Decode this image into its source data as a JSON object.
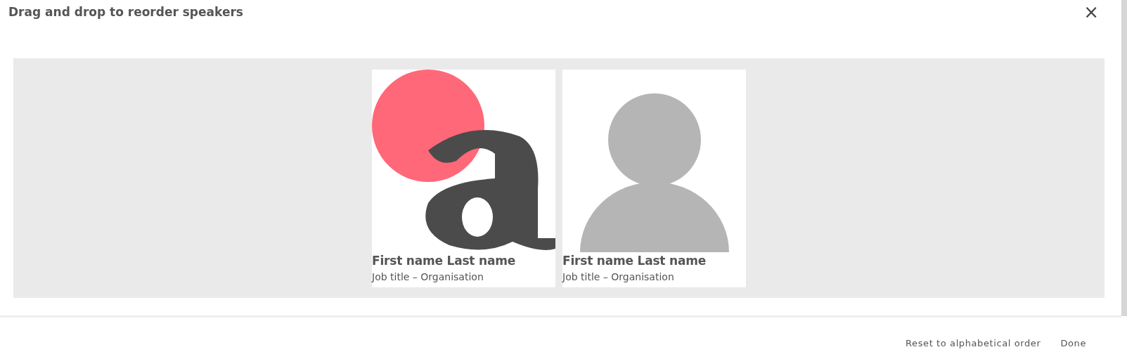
{
  "dialog": {
    "title": "Drag and drop to reorder speakers",
    "close": "×"
  },
  "speakers": [
    {
      "name": "First name Last name",
      "subtitle": "Job title – Organisation",
      "kind": "picture"
    },
    {
      "name": "First name Last name",
      "subtitle": "Job title – Organisation",
      "kind": "avatar"
    }
  ],
  "buttons": [
    "Reset to alphabetical order",
    "Done"
  ]
}
